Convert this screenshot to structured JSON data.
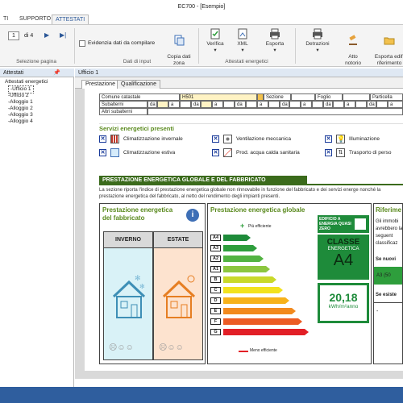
{
  "window": {
    "title": "EC700 - [Esempio]"
  },
  "ribbon_tabs": [
    "TI",
    "SUPPORTO",
    "ATTESTATI"
  ],
  "ribbon": {
    "page_nav": {
      "page": "1",
      "of_label": "di 4",
      "group_label": "Selezione pagina"
    },
    "input": {
      "checkbox_label": "Evidenzia dati da compilare",
      "copy_label": "Copia dati\nzona",
      "group_label": "Dati di input"
    },
    "energy": {
      "verify_label": "Verifica",
      "xml_label": "XML",
      "export_label": "Esporta",
      "group_label": "Attestati energetici"
    },
    "extra": {
      "detrazioni_label": "Detrazioni",
      "atto_label": "Atto\nnotorio",
      "export_buildings_label": "Esporta edifi\nriferimento"
    }
  },
  "sidebar": {
    "header": "Attestati",
    "pin": "✓",
    "root": "Attestati energetici",
    "items": [
      "Ufficio 1",
      "Ufficio 2",
      "Alloggio 1",
      "Alloggio 2",
      "Alloggio 3",
      "Alloggio 4"
    ]
  },
  "document": {
    "tab": "Ufficio 1",
    "inner_tabs": [
      "Prestazione",
      "Qualificazione"
    ],
    "cadastral": {
      "comune_label": "Comune catastale",
      "comune_value": "H501",
      "sezione_label": "Sezione",
      "foglio_label": "Foglio",
      "particella_label": "Particella",
      "subalterni_label": "Subalterni",
      "da_label": "da",
      "a_label": "a",
      "altri_label": "Altri subalterni"
    },
    "services": {
      "title": "Servizi energetici presenti",
      "items": [
        "Climatizzazione invernale",
        "Ventilazione meccanica",
        "Illuminazione",
        "Climatizzazione estiva",
        "Prod. acqua calda sanitaria",
        "Trasporto di perso"
      ]
    },
    "section_title": "PRESTAZIONE ENERGETICA GLOBALE E DEL FABBRICATO",
    "section_text": "La sezione riporta l'indice di prestazione energetica globale non rinnovabile in funzione del fabbricato e dei servizi energe nonché la prestazione energetica del fabbricato, al netto del rendimento degli impianti presenti.",
    "fabbricato": {
      "title": "Prestazione energetica del fabbricato",
      "inverno": "INVERNO",
      "estate": "ESTATE"
    },
    "globale": {
      "title": "Prestazione energetica globale",
      "piu_efficiente": "Più efficiente",
      "meno_efficiente": "Meno efficiente",
      "classes": [
        "A4",
        "A3",
        "A2",
        "A1",
        "B",
        "C",
        "D",
        "E",
        "F",
        "G"
      ],
      "class_colors": [
        "#1e8b3a",
        "#2e9e3c",
        "#52b342",
        "#8cc63f",
        "#c9d92a",
        "#f2e21e",
        "#f7b21a",
        "#f28a1e",
        "#ec5b24",
        "#e21f26"
      ],
      "nzeb_label": "EDIFICIO A ENERGIA QUASI ZERO",
      "classe_label": "CLASSE",
      "energetica_label": "ENERGETICA",
      "classe_value": "A4",
      "value": "20,18",
      "unit": "kWh/m²anno"
    },
    "riferimenti": {
      "title": "Riferime",
      "text": "Gli immobi avrebbero la seguent classificaz",
      "nuovo_label": "Se nuovi",
      "nuovo_value": "A3 (50",
      "esiste_label": "Se esiste",
      "esiste_value": "-"
    }
  }
}
